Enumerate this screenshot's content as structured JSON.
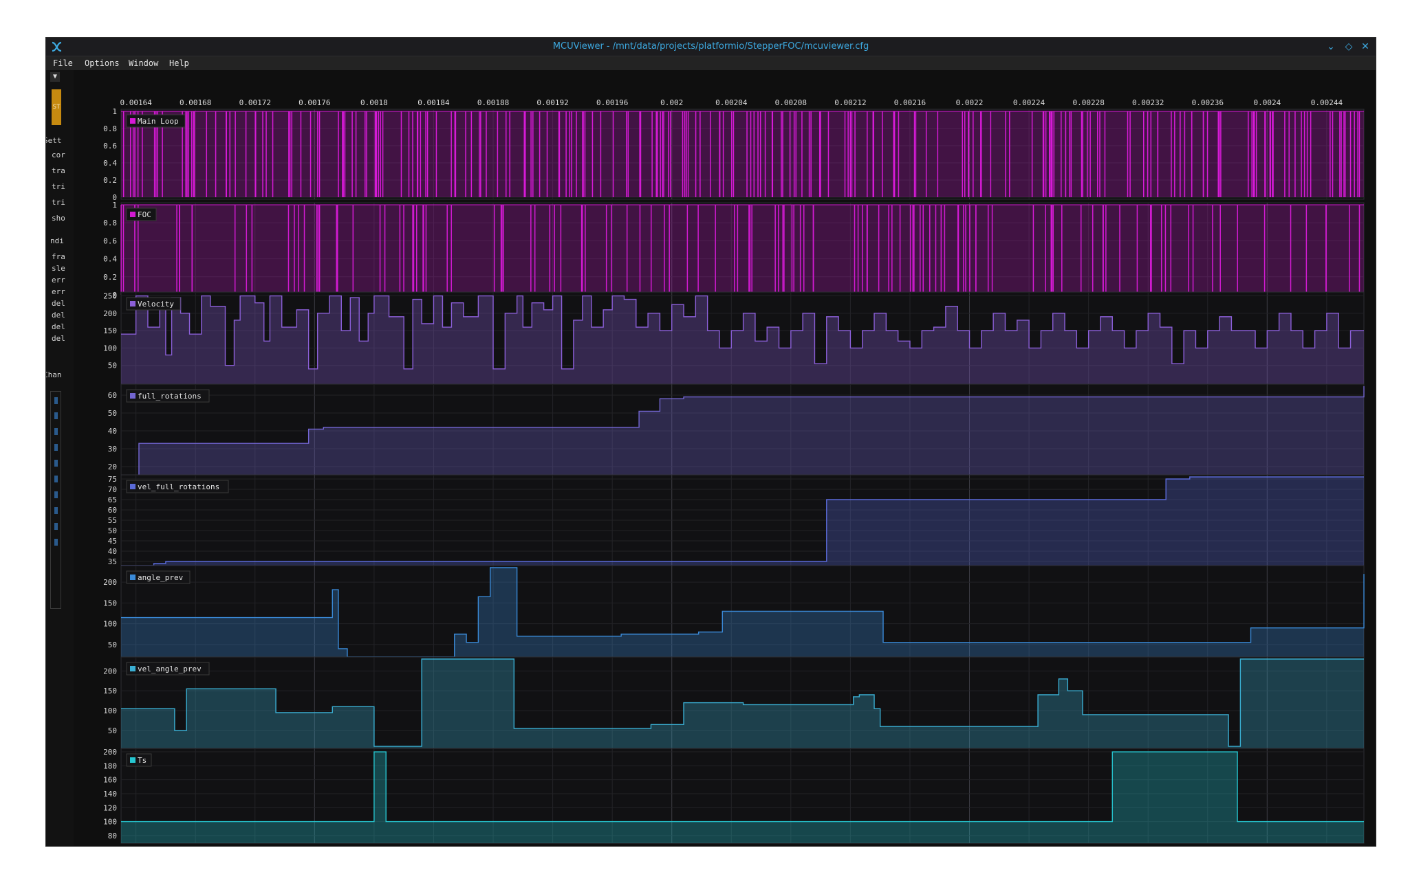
{
  "window": {
    "title": "MCUViewer - /mnt/data/projects/platformio/StepperFOC/mcuviewer.cfg",
    "controls": [
      "chevron-down-icon",
      "diamond-icon",
      "close-icon"
    ]
  },
  "menu": {
    "file": "File",
    "options": "Options",
    "window": "Window",
    "help": "Help"
  },
  "sidebar": {
    "dropdown": "▼",
    "start_label": "ST",
    "labels": [
      "Sett",
      "cor",
      "tra",
      "tri",
      "tri",
      "sho",
      "ndi",
      "fra",
      "sle",
      "err",
      "err",
      "del",
      "del",
      "del",
      "del",
      "Chan"
    ]
  },
  "time_axis": {
    "ticks": [
      "0.00164",
      "0.00168",
      "0.00172",
      "0.00176",
      "0.0018",
      "0.00184",
      "0.00188",
      "0.00192",
      "0.00196",
      "0.002",
      "0.00204",
      "0.00208",
      "0.00212",
      "0.00216",
      "0.0022",
      "0.00224",
      "0.00228",
      "0.00232",
      "0.00236",
      "0.0024",
      "0.00244"
    ],
    "range": [
      0.00163,
      0.002465
    ]
  },
  "chart_data": [
    {
      "type": "line",
      "name": "Main Loop",
      "color": "#d61ad6",
      "yticks": [
        "0",
        "0.2",
        "0.4",
        "0.6",
        "0.8",
        "1"
      ],
      "ylim": [
        0,
        1
      ],
      "signal": "square-wave pulses toggling between 0 and 1 at high frequency",
      "pulse_count": 230,
      "pulse_seed": 7
    },
    {
      "type": "line",
      "name": "FOC",
      "color": "#d21ad2",
      "yticks": [
        "0",
        "0.2",
        "0.4",
        "0.6",
        "0.8",
        "1"
      ],
      "ylim": [
        0,
        1
      ],
      "signal": "square-wave pulses toggling between 0 and 1",
      "pulse_count": 130,
      "pulse_seed": 19
    },
    {
      "type": "line",
      "name": "Velocity",
      "color": "#8b5fd8",
      "yticks": [
        "50",
        "100",
        "150",
        "200",
        "250"
      ],
      "ylim": [
        0,
        255
      ],
      "x": [
        0.00163,
        0.00164,
        0.001648,
        0.001656,
        0.00166,
        0.001664,
        0.00167,
        0.001676,
        0.001684,
        0.00169,
        0.0017,
        0.001706,
        0.00171,
        0.00172,
        0.001726,
        0.00173,
        0.001738,
        0.001748,
        0.001756,
        0.001762,
        0.00177,
        0.001778,
        0.001784,
        0.00179,
        0.001796,
        0.0018,
        0.00181,
        0.00182,
        0.001826,
        0.001832,
        0.00184,
        0.001846,
        0.001852,
        0.00186,
        0.00187,
        0.00188,
        0.001888,
        0.001896,
        0.0019,
        0.001906,
        0.001914,
        0.00192,
        0.001926,
        0.001934,
        0.00194,
        0.001946,
        0.001954,
        0.00196,
        0.001968,
        0.001976,
        0.001984,
        0.001992,
        0.002,
        0.002008,
        0.002016,
        0.002024,
        0.002032,
        0.00204,
        0.002048,
        0.002056,
        0.002064,
        0.002072,
        0.00208,
        0.002088,
        0.002096,
        0.002104,
        0.002112,
        0.00212,
        0.002128,
        0.002136,
        0.002144,
        0.002152,
        0.00216,
        0.002168,
        0.002176,
        0.002184,
        0.002192,
        0.0022,
        0.002208,
        0.002216,
        0.002224,
        0.002232,
        0.00224,
        0.002248,
        0.002256,
        0.002264,
        0.002272,
        0.00228,
        0.002288,
        0.002296,
        0.002304,
        0.002312,
        0.00232,
        0.002328,
        0.002336,
        0.002344,
        0.002352,
        0.00236,
        0.002368,
        0.002376,
        0.002384,
        0.002392,
        0.0024,
        0.002408,
        0.002416,
        0.002424,
        0.002432,
        0.00244,
        0.002448,
        0.002456
      ],
      "y": [
        140,
        250,
        160,
        240,
        80,
        245,
        200,
        140,
        250,
        220,
        50,
        180,
        250,
        230,
        120,
        250,
        160,
        210,
        40,
        200,
        250,
        150,
        245,
        120,
        200,
        250,
        190,
        40,
        240,
        170,
        250,
        160,
        230,
        190,
        250,
        40,
        200,
        250,
        160,
        230,
        210,
        250,
        40,
        180,
        250,
        160,
        210,
        250,
        240,
        160,
        200,
        150,
        225,
        190,
        250,
        150,
        100,
        150,
        200,
        120,
        160,
        100,
        150,
        200,
        55,
        190,
        150,
        100,
        150,
        200,
        150,
        120,
        100,
        150,
        160,
        220,
        150,
        100,
        150,
        200,
        150,
        180,
        100,
        150,
        200,
        150,
        100,
        150,
        190,
        150,
        100,
        150,
        200,
        160,
        55,
        150,
        100,
        150,
        190,
        150,
        150,
        100,
        150,
        200,
        150,
        100,
        150,
        200,
        100,
        150
      ],
      "style": "step"
    },
    {
      "type": "line",
      "name": "full_rotations",
      "color": "#7366d2",
      "yticks": [
        "20",
        "30",
        "40",
        "50",
        "60"
      ],
      "ylim": [
        15,
        65
      ],
      "x": [
        0.00163,
        0.001642,
        0.001736,
        0.001756,
        0.001766,
        0.001876,
        0.001978,
        0.001992,
        0.002008,
        0.00213,
        0.002465
      ],
      "y": [
        13,
        33,
        33,
        41,
        42,
        42,
        51,
        58,
        59,
        59,
        68
      ],
      "style": "step"
    },
    {
      "type": "line",
      "name": "vel_full_rotations",
      "color": "#5a6ad8",
      "yticks": [
        "35",
        "40",
        "45",
        "50",
        "55",
        "60",
        "65",
        "70",
        "75"
      ],
      "ylim": [
        33,
        76
      ],
      "x": [
        0.00163,
        0.001652,
        0.00166,
        0.002104,
        0.002332,
        0.002348,
        0.002465
      ],
      "y": [
        33,
        34,
        35,
        65,
        75,
        76,
        76
      ],
      "style": "step"
    },
    {
      "type": "line",
      "name": "angle_prev",
      "color": "#3a8ad8",
      "yticks": [
        "50",
        "100",
        "150",
        "200"
      ],
      "ylim": [
        20,
        235
      ],
      "x": [
        0.00163,
        0.001764,
        0.001772,
        0.001776,
        0.001782,
        0.001854,
        0.001862,
        0.00187,
        0.001878,
        0.001896,
        0.001904,
        0.00191,
        0.001966,
        0.002018,
        0.002028,
        0.002034,
        0.002142,
        0.002288,
        0.002389,
        0.002465
      ],
      "y": [
        115,
        115,
        182,
        40,
        15,
        75,
        55,
        165,
        235,
        70,
        70,
        70,
        75,
        80,
        80,
        130,
        55,
        55,
        90,
        220
      ],
      "style": "step"
    },
    {
      "type": "line",
      "name": "vel_angle_prev",
      "color": "#3aaed2",
      "yticks": [
        "50",
        "100",
        "150",
        "200"
      ],
      "ylim": [
        5,
        230
      ],
      "x": [
        0.00163,
        0.001666,
        0.001674,
        0.001734,
        0.001772,
        0.0018,
        0.001832,
        0.001894,
        0.00191,
        0.001986,
        0.002008,
        0.002032,
        0.002048,
        0.002122,
        0.002126,
        0.002136,
        0.00214,
        0.002246,
        0.00226,
        0.002266,
        0.002276,
        0.002374,
        0.002382,
        0.002406,
        0.002465
      ],
      "y": [
        105,
        50,
        155,
        95,
        110,
        10,
        230,
        55,
        55,
        65,
        120,
        120,
        115,
        135,
        140,
        105,
        60,
        140,
        180,
        150,
        90,
        10,
        230,
        230,
        235
      ],
      "style": "step"
    },
    {
      "type": "line",
      "name": "Ts",
      "color": "#26c6d0",
      "yticks": [
        "80",
        "100",
        "120",
        "140",
        "160",
        "180",
        "200"
      ],
      "ylim": [
        72,
        202
      ],
      "x": [
        0.00163,
        0.0018,
        0.001808,
        0.002296,
        0.00238,
        0.002465
      ],
      "y": [
        100,
        200,
        100,
        200,
        100,
        100
      ],
      "style": "step"
    }
  ]
}
